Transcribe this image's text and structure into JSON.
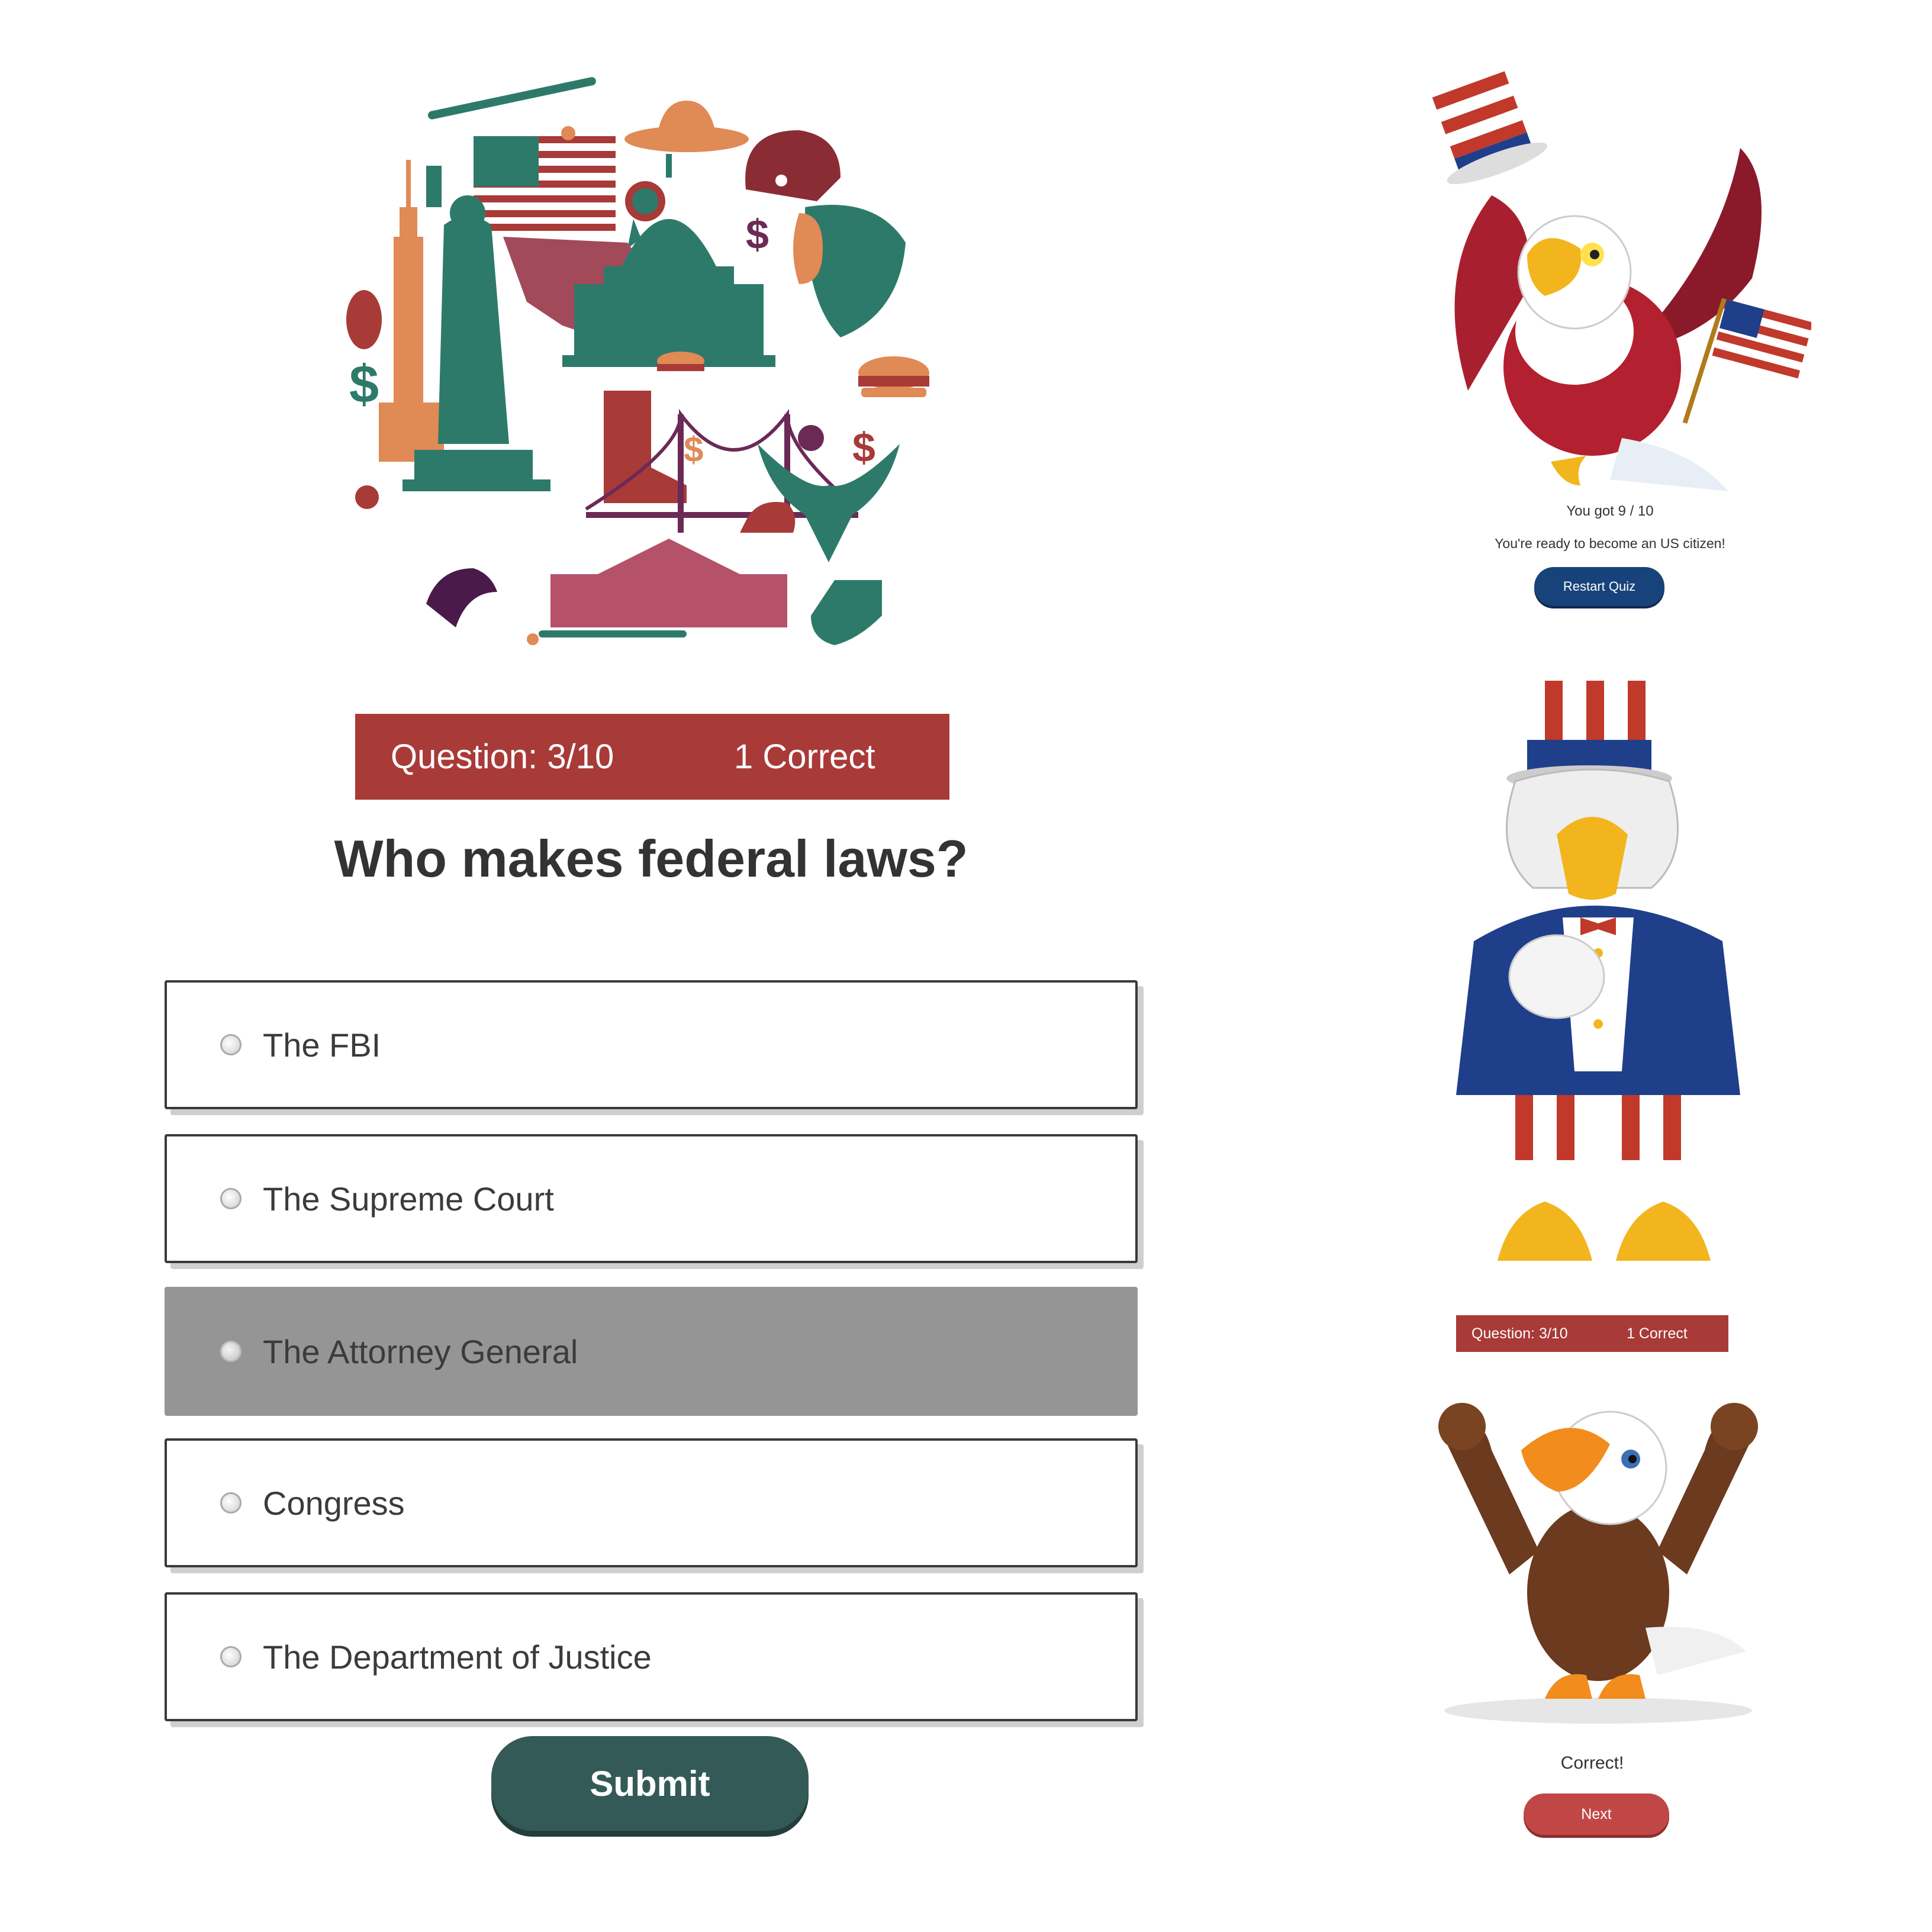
{
  "quiz": {
    "question_counter": "Question: 3/10",
    "correct_count": "1 Correct",
    "question": "Who makes federal laws?",
    "options": [
      {
        "label": "The FBI",
        "selected": false
      },
      {
        "label": "The Supreme Court",
        "selected": false
      },
      {
        "label": "The Attorney General",
        "selected": true
      },
      {
        "label": "Congress",
        "selected": false
      },
      {
        "label": "The Department of Justice",
        "selected": false
      }
    ],
    "submit_label": "Submit"
  },
  "results": {
    "score_text": "You got 9 / 10",
    "message": "You're ready to become an US citizen!",
    "restart_label": "Restart Quiz"
  },
  "feedback": {
    "question_counter": "Question: 3/10",
    "correct_count": "1 Correct",
    "result_text": "Correct!",
    "next_label": "Next"
  },
  "colors": {
    "stats_bar": "#a83a38",
    "submit": "#345a57",
    "restart": "#17437a",
    "next": "#c14747",
    "selected_option": "#959595"
  }
}
